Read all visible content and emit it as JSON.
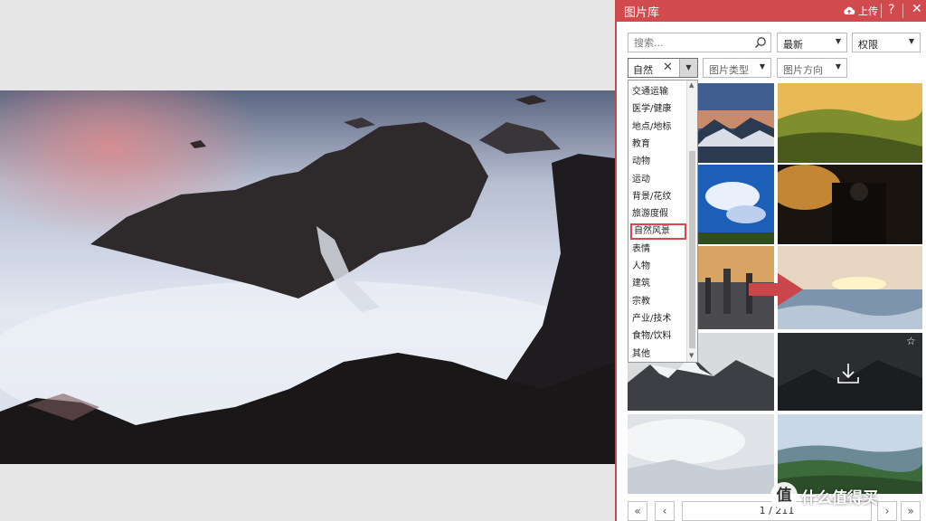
{
  "pane": {
    "title": "图片库",
    "upload_label": "上传",
    "help_label": "?",
    "close_label": "✕"
  },
  "search": {
    "placeholder": "搜索...",
    "value": ""
  },
  "filters": {
    "sort": "最新",
    "license": "权限",
    "category": "自然",
    "clear_label": "✕",
    "image_type": "图片类型",
    "orientation": "图片方向"
  },
  "category_list": [
    "交通运输",
    "医学/健康",
    "地点/地标",
    "教育",
    "动物",
    "运动",
    "背景/花纹",
    "旅游度假",
    "自然风景",
    "表情",
    "人物",
    "建筑",
    "宗教",
    "产业/技术",
    "食物/饮料",
    "其他"
  ],
  "selected_category": "自然风景",
  "pager": {
    "page_text": "1 / 211",
    "first_label": "«",
    "prev_label": "‹",
    "next_label": "›",
    "last_label": "»"
  },
  "watermark": {
    "logo": "值",
    "text": "什么值得买"
  },
  "colors": {
    "accent": "#d04a4e",
    "arrow": "#c9464a"
  },
  "icons": {
    "upload": "cloud-upload-icon",
    "search": "search-icon",
    "download": "download-icon",
    "star": "star-icon"
  }
}
